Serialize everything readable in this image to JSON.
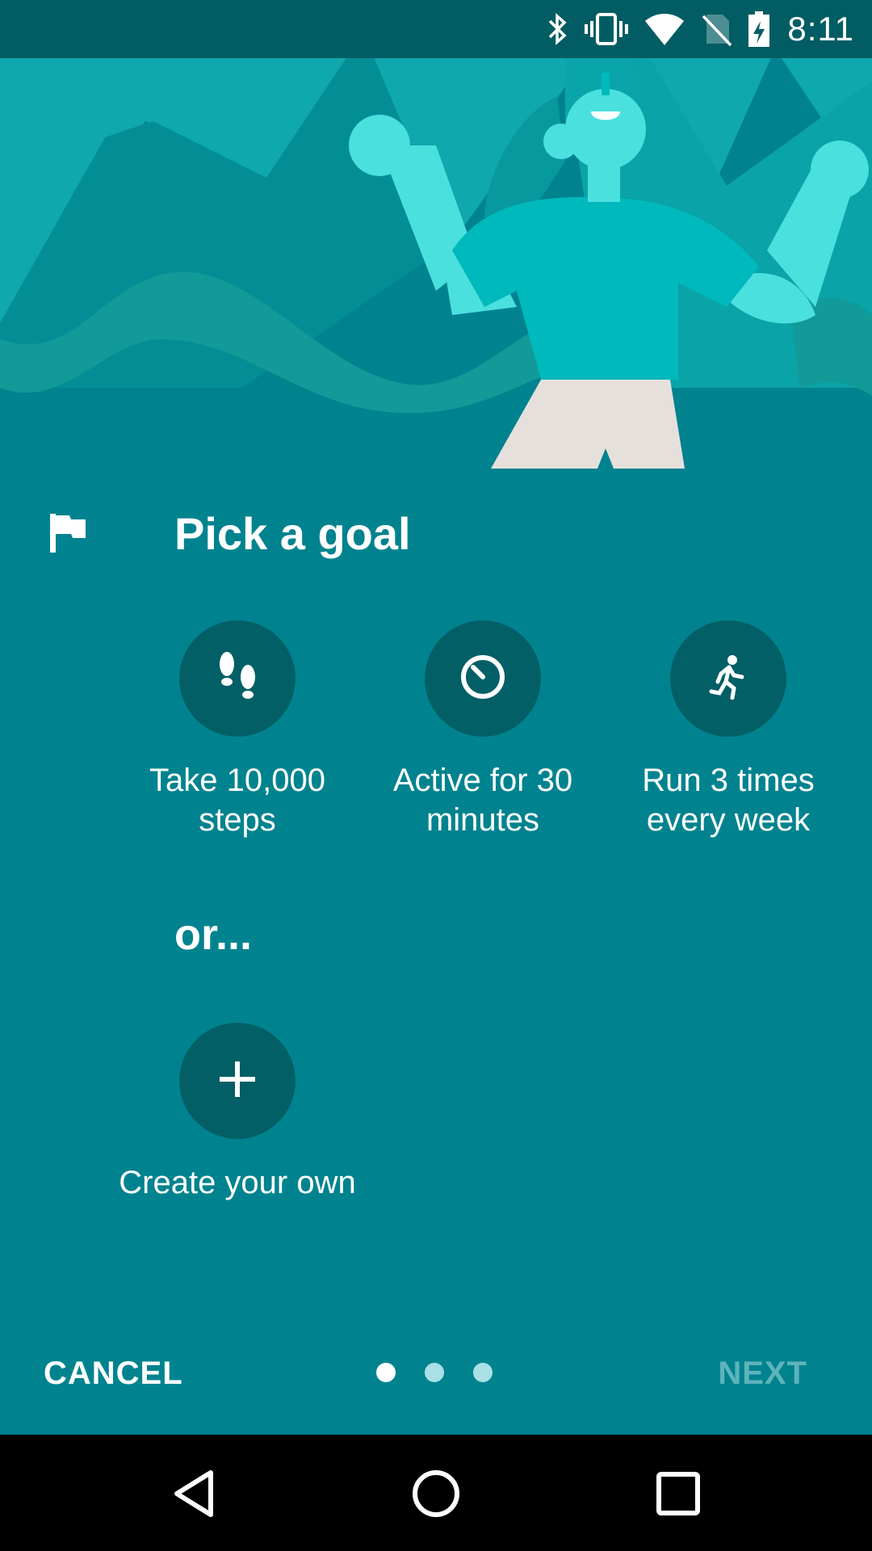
{
  "status_bar": {
    "time": "8:11",
    "icons": [
      "bluetooth-icon",
      "vibrate-icon",
      "wifi-icon",
      "no-sim-icon",
      "battery-charging-icon"
    ]
  },
  "header": {
    "title": "Pick a goal",
    "icon": "flag-icon"
  },
  "goals": [
    {
      "label": "Take 10,000 steps",
      "icon": "footsteps-icon"
    },
    {
      "label": "Active for 30 minutes",
      "icon": "timer-icon"
    },
    {
      "label": "Run 3 times every week",
      "icon": "running-icon"
    }
  ],
  "or_text": "or...",
  "custom_goal": {
    "label": "Create your own",
    "icon": "plus-icon"
  },
  "footer": {
    "cancel_label": "CANCEL",
    "next_label": "NEXT",
    "page_count": 3,
    "current_page": 1
  },
  "nav_bar": {
    "buttons": [
      "back-icon",
      "home-icon",
      "recents-icon"
    ]
  },
  "colors": {
    "background": "#00838f",
    "circle": "#025f66",
    "status_bar": "#015d63",
    "next_disabled": "#5fb3bb"
  }
}
